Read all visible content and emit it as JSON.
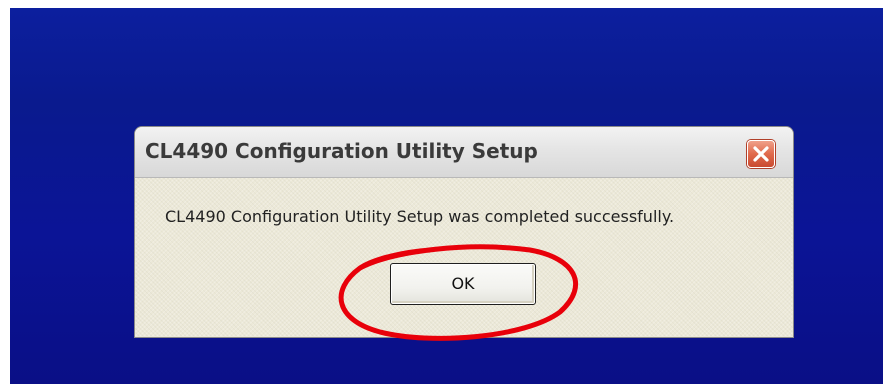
{
  "dialog": {
    "title": "CL4490 Configuration Utility Setup",
    "message": "CL4490 Configuration Utility Setup was completed successfully.",
    "ok_label": "OK",
    "close_icon": "close-icon"
  },
  "colors": {
    "desktop_blue": "#0b1496",
    "dialog_face": "#ece9d8",
    "close_button_red": "#e06a4c",
    "annotation_red": "#e8000a"
  }
}
